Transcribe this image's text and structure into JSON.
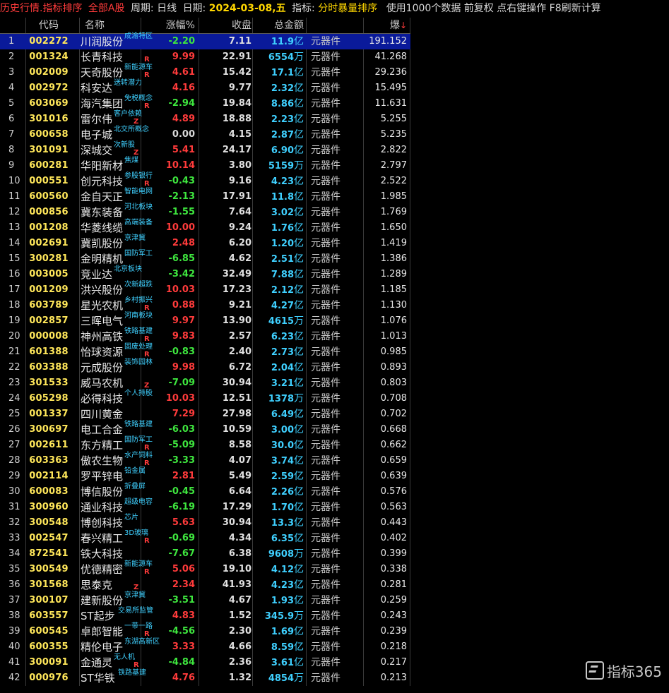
{
  "topbar": {
    "title": "历史行情.指标排序",
    "market": "全部A股",
    "period_label": "周期:",
    "period": "日线",
    "date_label": "日期:",
    "date": "2024-03-08,五",
    "indicator_label": "指标:",
    "indicator": "分时暴量排序",
    "tail": "使用1000个数据 前复权 点右键操作 F8刷新计算"
  },
  "headers": {
    "code": "代码",
    "name": "名称",
    "chg": "涨幅%",
    "close": "收盘",
    "amount": "总金额",
    "industry": "",
    "bao": "爆",
    "sort_arrow": "↓"
  },
  "rows": [
    {
      "i": "1",
      "code": "002272",
      "name": "川润股份",
      "tag": "成渝特区",
      "mark": "",
      "chg": "-2.20",
      "close": "7.11",
      "amt": "11.9",
      "unit": "亿",
      "ind": "元器件",
      "bao": "191.152"
    },
    {
      "i": "2",
      "code": "001324",
      "name": "长青科技",
      "tag": "",
      "mark": "R",
      "chg": "9.99",
      "close": "22.91",
      "amt": "6554",
      "unit": "万",
      "ind": "元器件",
      "bao": "41.268"
    },
    {
      "i": "3",
      "code": "002009",
      "name": "天奇股份",
      "tag": "新能源车",
      "mark": "R",
      "chg": "4.61",
      "close": "15.42",
      "amt": "17.1",
      "unit": "亿",
      "ind": "元器件",
      "bao": "29.236"
    },
    {
      "i": "4",
      "code": "002972",
      "name": "科安达",
      "tag": "送转潜力",
      "mark": "",
      "chg": "4.16",
      "close": "9.77",
      "amt": "2.32",
      "unit": "亿",
      "ind": "元器件",
      "bao": "15.495"
    },
    {
      "i": "5",
      "code": "603069",
      "name": "海汽集团",
      "tag": "免税概念",
      "mark": "R",
      "chg": "-2.94",
      "close": "19.84",
      "amt": "8.86",
      "unit": "亿",
      "ind": "元器件",
      "bao": "11.631"
    },
    {
      "i": "6",
      "code": "301016",
      "name": "雷尔伟",
      "tag": "客户依赖",
      "mark": "Z",
      "chg": "4.89",
      "close": "18.88",
      "amt": "2.23",
      "unit": "亿",
      "ind": "元器件",
      "bao": "5.255"
    },
    {
      "i": "7",
      "code": "600658",
      "name": "电子城",
      "tag": "北交所概念",
      "mark": "",
      "chg": "0.00",
      "close": "4.15",
      "amt": "2.87",
      "unit": "亿",
      "ind": "元器件",
      "bao": "5.235"
    },
    {
      "i": "8",
      "code": "301091",
      "name": "深城交",
      "tag": "次新股",
      "mark": "Z",
      "chg": "5.41",
      "close": "24.17",
      "amt": "6.90",
      "unit": "亿",
      "ind": "元器件",
      "bao": "2.822"
    },
    {
      "i": "9",
      "code": "600281",
      "name": "华阳新材",
      "tag": "焦煤",
      "mark": "",
      "chg": "10.14",
      "close": "3.80",
      "amt": "5159",
      "unit": "万",
      "ind": "元器件",
      "bao": "2.797"
    },
    {
      "i": "10",
      "code": "000551",
      "name": "创元科技",
      "tag": "参股银行",
      "mark": "R",
      "chg": "-0.43",
      "close": "9.16",
      "amt": "4.23",
      "unit": "亿",
      "ind": "元器件",
      "bao": "2.522"
    },
    {
      "i": "11",
      "code": "600560",
      "name": "金自天正",
      "tag": "智能电网",
      "mark": "",
      "chg": "-2.13",
      "close": "17.91",
      "amt": "11.8",
      "unit": "亿",
      "ind": "元器件",
      "bao": "1.985"
    },
    {
      "i": "12",
      "code": "000856",
      "name": "冀东装备",
      "tag": "河北板块",
      "mark": "",
      "chg": "-1.55",
      "close": "7.64",
      "amt": "3.02",
      "unit": "亿",
      "ind": "元器件",
      "bao": "1.769"
    },
    {
      "i": "13",
      "code": "001208",
      "name": "华菱线缆",
      "tag": "高端装备",
      "mark": "",
      "chg": "10.00",
      "close": "9.24",
      "amt": "1.76",
      "unit": "亿",
      "ind": "元器件",
      "bao": "1.650"
    },
    {
      "i": "14",
      "code": "002691",
      "name": "冀凯股份",
      "tag": "京津冀",
      "mark": "",
      "chg": "2.48",
      "close": "6.20",
      "amt": "1.20",
      "unit": "亿",
      "ind": "元器件",
      "bao": "1.419"
    },
    {
      "i": "15",
      "code": "300281",
      "name": "金明精机",
      "tag": "国防军工",
      "mark": "",
      "chg": "-6.85",
      "close": "4.62",
      "amt": "2.51",
      "unit": "亿",
      "ind": "元器件",
      "bao": "1.386"
    },
    {
      "i": "16",
      "code": "003005",
      "name": "竞业达",
      "tag": "北京板块",
      "mark": "",
      "chg": "-3.42",
      "close": "32.49",
      "amt": "7.88",
      "unit": "亿",
      "ind": "元器件",
      "bao": "1.289"
    },
    {
      "i": "17",
      "code": "001209",
      "name": "洪兴股份",
      "tag": "次新超跌",
      "mark": "",
      "chg": "10.03",
      "close": "17.23",
      "amt": "2.12",
      "unit": "亿",
      "ind": "元器件",
      "bao": "1.185"
    },
    {
      "i": "18",
      "code": "603789",
      "name": "星光农机",
      "tag": "乡村振兴",
      "mark": "R",
      "chg": "0.88",
      "close": "9.21",
      "amt": "4.27",
      "unit": "亿",
      "ind": "元器件",
      "bao": "1.130"
    },
    {
      "i": "19",
      "code": "002857",
      "name": "三晖电气",
      "tag": "河南板块",
      "mark": "",
      "chg": "9.97",
      "close": "13.90",
      "amt": "4615",
      "unit": "万",
      "ind": "元器件",
      "bao": "1.076"
    },
    {
      "i": "20",
      "code": "000008",
      "name": "神州高铁",
      "tag": "铁路基建",
      "mark": "R",
      "chg": "9.83",
      "close": "2.57",
      "amt": "6.23",
      "unit": "亿",
      "ind": "元器件",
      "bao": "1.013"
    },
    {
      "i": "21",
      "code": "601388",
      "name": "怡球资源",
      "tag": "固废处理",
      "mark": "R",
      "chg": "-0.83",
      "close": "2.40",
      "amt": "2.73",
      "unit": "亿",
      "ind": "元器件",
      "bao": "0.985"
    },
    {
      "i": "22",
      "code": "603388",
      "name": "元成股份",
      "tag": "装饰园林",
      "mark": "",
      "chg": "9.98",
      "close": "6.72",
      "amt": "2.04",
      "unit": "亿",
      "ind": "元器件",
      "bao": "0.893"
    },
    {
      "i": "23",
      "code": "301533",
      "name": "威马农机",
      "tag": "",
      "mark": "Z",
      "chg": "-7.09",
      "close": "30.94",
      "amt": "3.21",
      "unit": "亿",
      "ind": "元器件",
      "bao": "0.803"
    },
    {
      "i": "24",
      "code": "605298",
      "name": "必得科技",
      "tag": "个人持股",
      "mark": "",
      "chg": "10.03",
      "close": "12.51",
      "amt": "1378",
      "unit": "万",
      "ind": "元器件",
      "bao": "0.708"
    },
    {
      "i": "25",
      "code": "001337",
      "name": "四川黄金",
      "tag": "",
      "mark": "",
      "chg": "7.29",
      "close": "27.98",
      "amt": "6.49",
      "unit": "亿",
      "ind": "元器件",
      "bao": "0.702"
    },
    {
      "i": "26",
      "code": "300697",
      "name": "电工合金",
      "tag": "铁路基建",
      "mark": "",
      "chg": "-6.03",
      "close": "10.59",
      "amt": "3.00",
      "unit": "亿",
      "ind": "元器件",
      "bao": "0.668"
    },
    {
      "i": "27",
      "code": "002611",
      "name": "东方精工",
      "tag": "国防军工",
      "mark": "R",
      "chg": "-5.09",
      "close": "8.58",
      "amt": "30.0",
      "unit": "亿",
      "ind": "元器件",
      "bao": "0.662"
    },
    {
      "i": "28",
      "code": "603363",
      "name": "傲农生物",
      "tag": "水产饲料",
      "mark": "R",
      "chg": "-3.33",
      "close": "4.07",
      "amt": "3.74",
      "unit": "亿",
      "ind": "元器件",
      "bao": "0.659"
    },
    {
      "i": "29",
      "code": "002114",
      "name": "罗平锌电",
      "tag": "铅金属",
      "mark": "",
      "chg": "2.81",
      "close": "5.49",
      "amt": "2.59",
      "unit": "亿",
      "ind": "元器件",
      "bao": "0.639"
    },
    {
      "i": "30",
      "code": "600083",
      "name": "博信股份",
      "tag": "折叠屏",
      "mark": "",
      "chg": "-0.45",
      "close": "6.64",
      "amt": "2.26",
      "unit": "亿",
      "ind": "元器件",
      "bao": "0.576"
    },
    {
      "i": "31",
      "code": "300960",
      "name": "通业科技",
      "tag": "超级电容",
      "mark": "",
      "chg": "-6.19",
      "close": "17.29",
      "amt": "1.70",
      "unit": "亿",
      "ind": "元器件",
      "bao": "0.563"
    },
    {
      "i": "32",
      "code": "300548",
      "name": "博创科技",
      "tag": "芯片",
      "mark": "",
      "chg": "5.63",
      "close": "30.94",
      "amt": "13.3",
      "unit": "亿",
      "ind": "元器件",
      "bao": "0.443"
    },
    {
      "i": "33",
      "code": "002547",
      "name": "春兴精工",
      "tag": "3D玻璃",
      "mark": "R",
      "chg": "-0.69",
      "close": "4.34",
      "amt": "6.35",
      "unit": "亿",
      "ind": "元器件",
      "bao": "0.402"
    },
    {
      "i": "34",
      "code": "872541",
      "name": "铁大科技",
      "tag": "",
      "mark": "",
      "chg": "-7.67",
      "close": "6.38",
      "amt": "9608",
      "unit": "万",
      "ind": "元器件",
      "bao": "0.399"
    },
    {
      "i": "35",
      "code": "300549",
      "name": "优德精密",
      "tag": "新能源车",
      "mark": "R",
      "chg": "5.06",
      "close": "19.10",
      "amt": "4.12",
      "unit": "亿",
      "ind": "元器件",
      "bao": "0.338"
    },
    {
      "i": "36",
      "code": "301568",
      "name": "思泰克",
      "tag": "",
      "mark": "Z",
      "chg": "2.34",
      "close": "41.93",
      "amt": "4.23",
      "unit": "亿",
      "ind": "元器件",
      "bao": "0.281"
    },
    {
      "i": "37",
      "code": "300107",
      "name": "建新股份",
      "tag": "京津冀",
      "mark": "",
      "chg": "-3.51",
      "close": "4.67",
      "amt": "1.93",
      "unit": "亿",
      "ind": "元器件",
      "bao": "0.259"
    },
    {
      "i": "38",
      "code": "603557",
      "name": "ST起步",
      "tag": "交易所监管",
      "mark": "",
      "chg": "4.83",
      "close": "1.52",
      "amt": "345.9",
      "unit": "万",
      "ind": "元器件",
      "bao": "0.243"
    },
    {
      "i": "39",
      "code": "600545",
      "name": "卓郎智能",
      "tag": "一带一路",
      "mark": "R",
      "chg": "-4.56",
      "close": "2.30",
      "amt": "1.69",
      "unit": "亿",
      "ind": "元器件",
      "bao": "0.239"
    },
    {
      "i": "40",
      "code": "600355",
      "name": "精伦电子",
      "tag": "东湖高新区",
      "mark": "",
      "chg": "3.33",
      "close": "4.66",
      "amt": "8.59",
      "unit": "亿",
      "ind": "元器件",
      "bao": "0.218"
    },
    {
      "i": "41",
      "code": "300091",
      "name": "金通灵",
      "tag": "无人机",
      "mark": "R",
      "chg": "-4.84",
      "close": "2.36",
      "amt": "3.61",
      "unit": "亿",
      "ind": "元器件",
      "bao": "0.217"
    },
    {
      "i": "42",
      "code": "000976",
      "name": "ST华铁",
      "tag": "铁路基建",
      "mark": "",
      "chg": "4.76",
      "close": "1.32",
      "amt": "4854",
      "unit": "万",
      "ind": "元器件",
      "bao": "0.213"
    }
  ],
  "watermark": {
    "icon": "zhibiao365-logo-icon",
    "text": "指标365"
  },
  "colors": {
    "up": "#ff3b3b",
    "down": "#3ee63e",
    "code": "#ffe75a",
    "amount": "#3fd0ff",
    "tag": "#3fd0ff",
    "selected_row": "#0a1a9a"
  }
}
